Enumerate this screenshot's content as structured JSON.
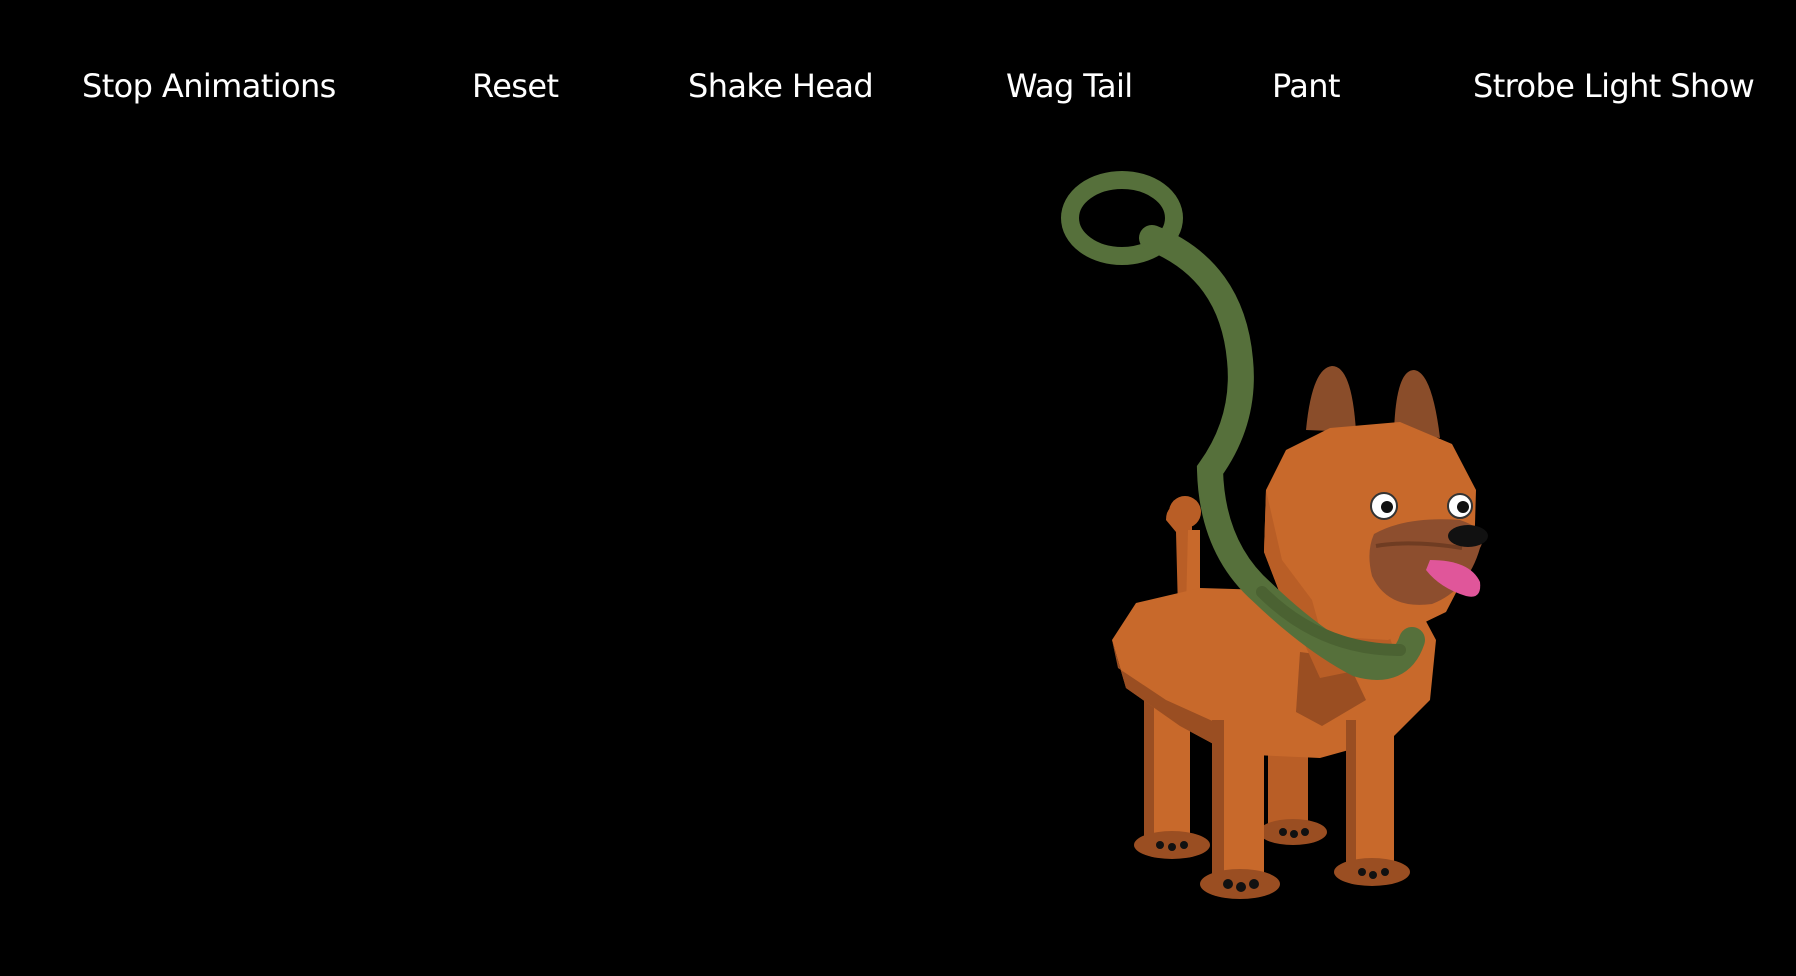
{
  "toolbar": {
    "buttons": [
      {
        "id": "stop",
        "label": "Stop Animations"
      },
      {
        "id": "reset",
        "label": "Reset"
      },
      {
        "id": "shake",
        "label": "Shake Head"
      },
      {
        "id": "wag",
        "label": "Wag Tail"
      },
      {
        "id": "pant",
        "label": "Pant"
      },
      {
        "id": "strobe",
        "label": "Strobe Light Show"
      }
    ]
  },
  "scene": {
    "background_color": "#000000",
    "subject": "dog",
    "colors": {
      "body": "#c8692b",
      "body_shadow": "#9a4e22",
      "ear": "#8a4d2a",
      "muzzle": "#8d4e2e",
      "leash": "#56703b",
      "tongue": "#e0569a",
      "nose": "#111111",
      "paw": "#9a4e22"
    }
  }
}
